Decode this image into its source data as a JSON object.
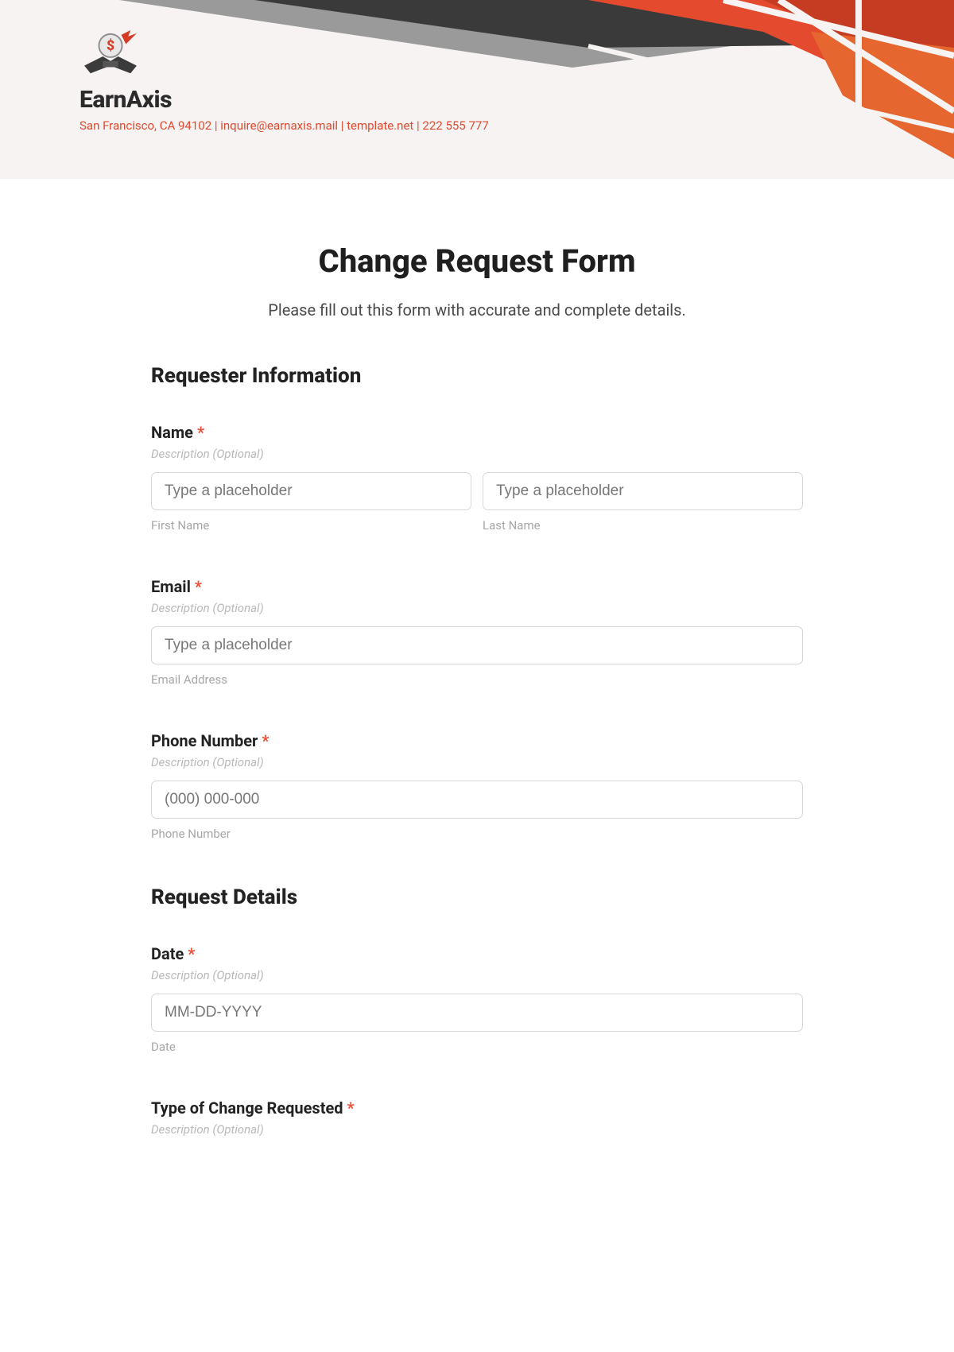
{
  "header": {
    "brand": "EarnAxis",
    "tagline": "San Francisco, CA 94102 | inquire@earnaxis.mail | template.net | 222 555 777"
  },
  "form": {
    "title": "Change Request Form",
    "subtitle": "Please fill out this form with accurate and complete details.",
    "sections": [
      {
        "heading": "Requester Information",
        "fields": {
          "name": {
            "label": "Name",
            "required": "*",
            "desc": "Description (Optional)",
            "first_placeholder": "Type a placeholder",
            "first_sublabel": "First Name",
            "last_placeholder": "Type a placeholder",
            "last_sublabel": "Last Name"
          },
          "email": {
            "label": "Email",
            "required": "*",
            "desc": "Description (Optional)",
            "placeholder": "Type a placeholder",
            "sublabel": "Email Address"
          },
          "phone": {
            "label": "Phone Number",
            "required": "*",
            "desc": "Description (Optional)",
            "placeholder": "(000) 000-000",
            "sublabel": "Phone Number"
          }
        }
      },
      {
        "heading": "Request Details",
        "fields": {
          "date": {
            "label": "Date",
            "required": "*",
            "desc": "Description (Optional)",
            "placeholder": "MM-DD-YYYY",
            "sublabel": "Date"
          },
          "type": {
            "label": "Type of Change Requested",
            "required": "*",
            "desc": "Description (Optional)"
          }
        }
      }
    ]
  }
}
